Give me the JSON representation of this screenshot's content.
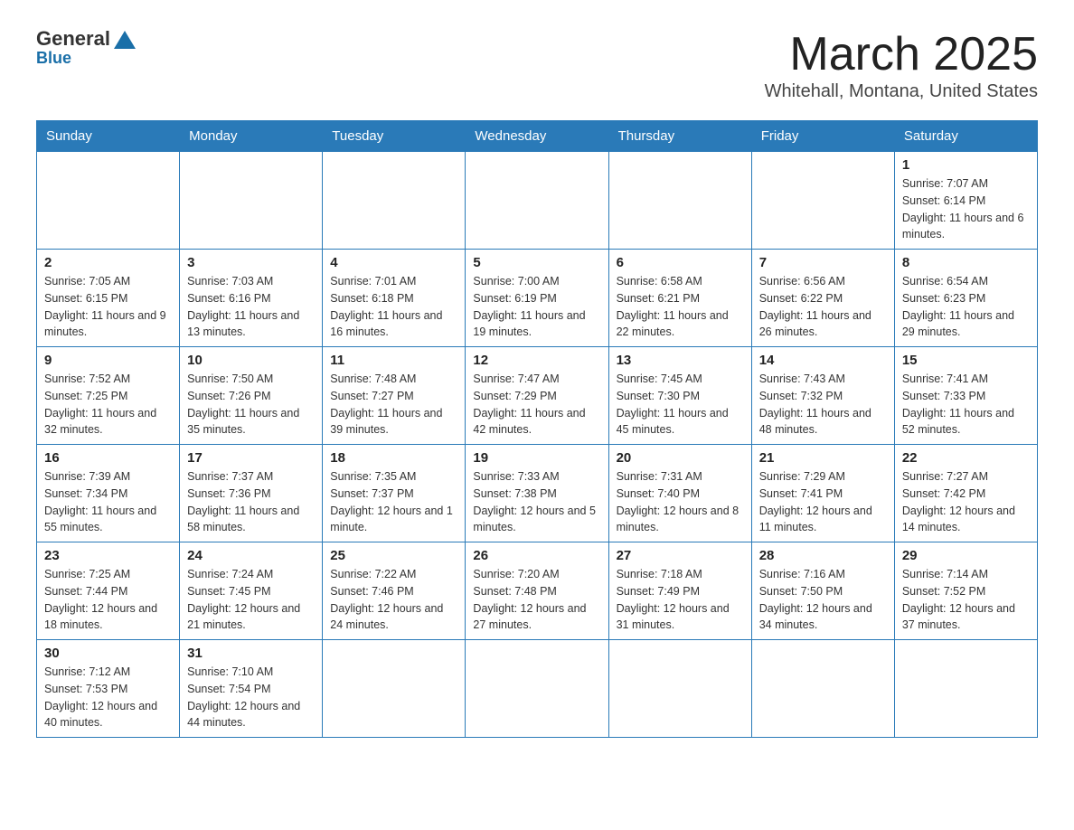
{
  "logo": {
    "general": "General",
    "blue": "Blue",
    "triangle_color": "#1a6fa8"
  },
  "title": "March 2025",
  "subtitle": "Whitehall, Montana, United States",
  "days_of_week": [
    "Sunday",
    "Monday",
    "Tuesday",
    "Wednesday",
    "Thursday",
    "Friday",
    "Saturday"
  ],
  "weeks": [
    [
      null,
      null,
      null,
      null,
      null,
      null,
      {
        "day": "1",
        "sunrise": "Sunrise: 7:07 AM",
        "sunset": "Sunset: 6:14 PM",
        "daylight": "Daylight: 11 hours and 6 minutes."
      }
    ],
    [
      {
        "day": "2",
        "sunrise": "Sunrise: 7:05 AM",
        "sunset": "Sunset: 6:15 PM",
        "daylight": "Daylight: 11 hours and 9 minutes."
      },
      {
        "day": "3",
        "sunrise": "Sunrise: 7:03 AM",
        "sunset": "Sunset: 6:16 PM",
        "daylight": "Daylight: 11 hours and 13 minutes."
      },
      {
        "day": "4",
        "sunrise": "Sunrise: 7:01 AM",
        "sunset": "Sunset: 6:18 PM",
        "daylight": "Daylight: 11 hours and 16 minutes."
      },
      {
        "day": "5",
        "sunrise": "Sunrise: 7:00 AM",
        "sunset": "Sunset: 6:19 PM",
        "daylight": "Daylight: 11 hours and 19 minutes."
      },
      {
        "day": "6",
        "sunrise": "Sunrise: 6:58 AM",
        "sunset": "Sunset: 6:21 PM",
        "daylight": "Daylight: 11 hours and 22 minutes."
      },
      {
        "day": "7",
        "sunrise": "Sunrise: 6:56 AM",
        "sunset": "Sunset: 6:22 PM",
        "daylight": "Daylight: 11 hours and 26 minutes."
      },
      {
        "day": "8",
        "sunrise": "Sunrise: 6:54 AM",
        "sunset": "Sunset: 6:23 PM",
        "daylight": "Daylight: 11 hours and 29 minutes."
      }
    ],
    [
      {
        "day": "9",
        "sunrise": "Sunrise: 7:52 AM",
        "sunset": "Sunset: 7:25 PM",
        "daylight": "Daylight: 11 hours and 32 minutes."
      },
      {
        "day": "10",
        "sunrise": "Sunrise: 7:50 AM",
        "sunset": "Sunset: 7:26 PM",
        "daylight": "Daylight: 11 hours and 35 minutes."
      },
      {
        "day": "11",
        "sunrise": "Sunrise: 7:48 AM",
        "sunset": "Sunset: 7:27 PM",
        "daylight": "Daylight: 11 hours and 39 minutes."
      },
      {
        "day": "12",
        "sunrise": "Sunrise: 7:47 AM",
        "sunset": "Sunset: 7:29 PM",
        "daylight": "Daylight: 11 hours and 42 minutes."
      },
      {
        "day": "13",
        "sunrise": "Sunrise: 7:45 AM",
        "sunset": "Sunset: 7:30 PM",
        "daylight": "Daylight: 11 hours and 45 minutes."
      },
      {
        "day": "14",
        "sunrise": "Sunrise: 7:43 AM",
        "sunset": "Sunset: 7:32 PM",
        "daylight": "Daylight: 11 hours and 48 minutes."
      },
      {
        "day": "15",
        "sunrise": "Sunrise: 7:41 AM",
        "sunset": "Sunset: 7:33 PM",
        "daylight": "Daylight: 11 hours and 52 minutes."
      }
    ],
    [
      {
        "day": "16",
        "sunrise": "Sunrise: 7:39 AM",
        "sunset": "Sunset: 7:34 PM",
        "daylight": "Daylight: 11 hours and 55 minutes."
      },
      {
        "day": "17",
        "sunrise": "Sunrise: 7:37 AM",
        "sunset": "Sunset: 7:36 PM",
        "daylight": "Daylight: 11 hours and 58 minutes."
      },
      {
        "day": "18",
        "sunrise": "Sunrise: 7:35 AM",
        "sunset": "Sunset: 7:37 PM",
        "daylight": "Daylight: 12 hours and 1 minute."
      },
      {
        "day": "19",
        "sunrise": "Sunrise: 7:33 AM",
        "sunset": "Sunset: 7:38 PM",
        "daylight": "Daylight: 12 hours and 5 minutes."
      },
      {
        "day": "20",
        "sunrise": "Sunrise: 7:31 AM",
        "sunset": "Sunset: 7:40 PM",
        "daylight": "Daylight: 12 hours and 8 minutes."
      },
      {
        "day": "21",
        "sunrise": "Sunrise: 7:29 AM",
        "sunset": "Sunset: 7:41 PM",
        "daylight": "Daylight: 12 hours and 11 minutes."
      },
      {
        "day": "22",
        "sunrise": "Sunrise: 7:27 AM",
        "sunset": "Sunset: 7:42 PM",
        "daylight": "Daylight: 12 hours and 14 minutes."
      }
    ],
    [
      {
        "day": "23",
        "sunrise": "Sunrise: 7:25 AM",
        "sunset": "Sunset: 7:44 PM",
        "daylight": "Daylight: 12 hours and 18 minutes."
      },
      {
        "day": "24",
        "sunrise": "Sunrise: 7:24 AM",
        "sunset": "Sunset: 7:45 PM",
        "daylight": "Daylight: 12 hours and 21 minutes."
      },
      {
        "day": "25",
        "sunrise": "Sunrise: 7:22 AM",
        "sunset": "Sunset: 7:46 PM",
        "daylight": "Daylight: 12 hours and 24 minutes."
      },
      {
        "day": "26",
        "sunrise": "Sunrise: 7:20 AM",
        "sunset": "Sunset: 7:48 PM",
        "daylight": "Daylight: 12 hours and 27 minutes."
      },
      {
        "day": "27",
        "sunrise": "Sunrise: 7:18 AM",
        "sunset": "Sunset: 7:49 PM",
        "daylight": "Daylight: 12 hours and 31 minutes."
      },
      {
        "day": "28",
        "sunrise": "Sunrise: 7:16 AM",
        "sunset": "Sunset: 7:50 PM",
        "daylight": "Daylight: 12 hours and 34 minutes."
      },
      {
        "day": "29",
        "sunrise": "Sunrise: 7:14 AM",
        "sunset": "Sunset: 7:52 PM",
        "daylight": "Daylight: 12 hours and 37 minutes."
      }
    ],
    [
      {
        "day": "30",
        "sunrise": "Sunrise: 7:12 AM",
        "sunset": "Sunset: 7:53 PM",
        "daylight": "Daylight: 12 hours and 40 minutes."
      },
      {
        "day": "31",
        "sunrise": "Sunrise: 7:10 AM",
        "sunset": "Sunset: 7:54 PM",
        "daylight": "Daylight: 12 hours and 44 minutes."
      },
      null,
      null,
      null,
      null,
      null
    ]
  ]
}
